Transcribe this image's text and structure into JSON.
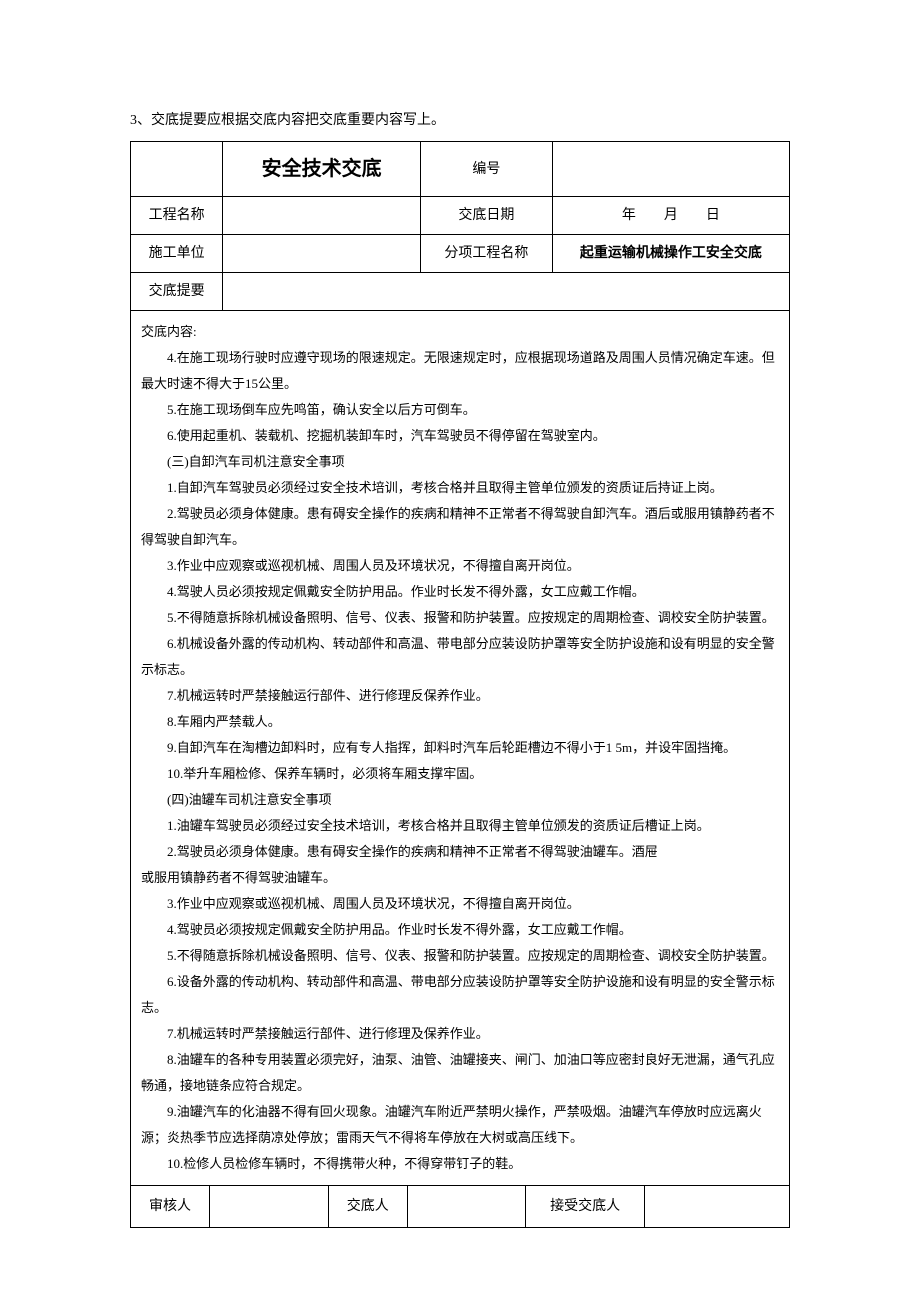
{
  "note": "3、交底提要应根据交底内容把交底重要内容写上。",
  "header": {
    "title": "安全技术交底",
    "number_label": "编号",
    "number_value": "",
    "project_name_label": "工程名称",
    "project_name_value": "",
    "date_label": "交底日期",
    "date_value": "年　　月　　日",
    "unit_label": "施工单位",
    "unit_value": "",
    "subproject_label": "分项工程名称",
    "subproject_value": "起重运输机械操作工安全交底",
    "summary_label": "交底提要",
    "summary_value": ""
  },
  "content": {
    "heading": "交底内容:",
    "paragraphs": [
      "4.在施工现场行驶时应遵守现场的限速规定。无限速规定时，应根据现场道路及周围人员情况确定车速。但最大时速不得大于15公里。",
      "5.在施工现场倒车应先鸣笛，确认安全以后方可倒车。",
      "6.使用起重机、装载机、挖掘机装卸车时，汽车驾驶员不得停留在驾驶室内。",
      "(三)自卸汽车司机注意安全事项",
      "1.自卸汽车驾驶员必须经过安全技术培训，考核合格并且取得主管单位颁发的资质证后持证上岗。",
      "2.驾驶员必须身体健康。患有碍安全操作的疾病和精神不正常者不得驾驶自卸汽车。酒后或服用镇静药者不得驾驶自卸汽车。",
      "3.作业中应观察或巡视机械、周围人员及环境状况，不得擅自离开岗位。",
      "4.驾驶人员必须按规定佩戴安全防护用品。作业时长发不得外露，女工应戴工作帽。",
      "5.不得随意拆除机械设备照明、信号、仪表、报警和防护装置。应按规定的周期检查、调校安全防护装置。",
      "6.机械设备外露的传动机构、转动部件和高温、带电部分应装设防护罩等安全防护设施和设有明显的安全警示标志。",
      "7.机械运转时严禁接触运行部件、进行修理反保养作业。",
      "8.车厢内严禁载人。",
      "9.自卸汽车在淘槽边卸料时，应有专人指挥，卸料时汽车后轮距槽边不得小于1 5m，并设牢固挡掩。",
      "10.举升车厢检修、保养车辆时，必须将车厢支撑牢固。",
      "(四)油罐车司机注意安全事项",
      "1.油罐车驾驶员必须经过安全技术培训，考核合格并且取得主管单位颁发的资质证后槽证上岗。",
      "2.驾驶员必须身体健康。患有碍安全操作的疾病和精神不正常者不得驾驶油罐车。酒屉",
      "或服用镇静药者不得驾驶油罐车。",
      "3.作业中应观察或巡视机械、周围人员及环境状况，不得擅自离开岗位。",
      "4.驾驶员必须按规定佩戴安全防护用品。作业时长发不得外露，女工应戴工作帽。",
      "5.不得随意拆除机械设备照明、信号、仪表、报警和防护装置。应按规定的周期检查、调校安全防护装置。",
      "6.设备外露的传动机构、转动部件和高温、带电部分应装设防护罩等安全防护设施和设有明显的安全警示标志。",
      "7.机械运转时严禁接触运行部件、进行修理及保养作业。",
      "8.油罐车的各种专用装置必须完好，油泵、油管、油罐接夹、闸门、加油口等应密封良好无泄漏，通气孔应畅通，接地链条应符合规定。",
      "9.油罐汽车的化油器不得有回火现象。油罐汽车附近严禁明火操作，严禁吸烟。油罐汽车停放时应远离火源；炎热季节应选择荫凉处停放；雷雨天气不得将车停放在大树或高压线下。",
      "10.检修人员检修车辆时，不得携带火种，不得穿带钉子的鞋。"
    ]
  },
  "footer": {
    "reviewer_label": "审核人",
    "reviewer_value": "",
    "discloser_label": "交底人",
    "discloser_value": "",
    "receiver_label": "接受交底人",
    "receiver_value": ""
  }
}
